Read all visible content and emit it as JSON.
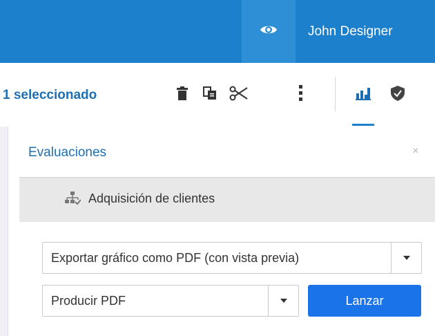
{
  "header": {
    "user_name": "John Designer",
    "eye_icon": "eye-icon"
  },
  "toolbar": {
    "selected_text": "1 seleccionado",
    "icons": [
      "trash-icon",
      "copy-icon",
      "scissors-icon",
      "more-vertical-icon",
      "bar-chart-icon",
      "shield-icon"
    ]
  },
  "panel": {
    "title": "Evaluaciones",
    "close_glyph": "×",
    "section_label": "Adquisición de clientes",
    "section_icon": "hierarchy-icon",
    "export_select_value": "Exportar gráfico como PDF (con vista previa)",
    "action_select_value": "Producir PDF",
    "launch_label": "Lanzar"
  },
  "colors": {
    "topbar": "#1d80cc",
    "accent": "#1d6fb3",
    "primary_button": "#1a73e8"
  }
}
